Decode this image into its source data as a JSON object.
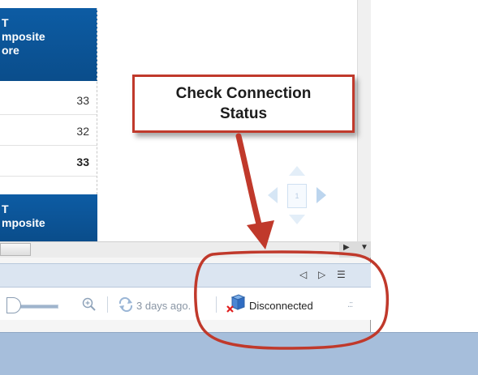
{
  "report_table": {
    "header_1_lines": [
      "T",
      "mposite",
      "ore"
    ],
    "rows": [
      "33",
      "32",
      "33"
    ],
    "header_2_lines": [
      "T",
      "mposite"
    ]
  },
  "page_navigator": {
    "page_number": "1"
  },
  "page_tabs": {
    "prev_icon": "◁",
    "next_icon": "▷",
    "list_icon": "☰"
  },
  "status_bar": {
    "zoom_in_icon": "🔍",
    "refresh_text": "3 days ago.",
    "connection_status": "Disconnected"
  },
  "annotation": {
    "callout_line_1": "Check Connection",
    "callout_line_2": "Status",
    "accent_color": "#c0392b"
  }
}
